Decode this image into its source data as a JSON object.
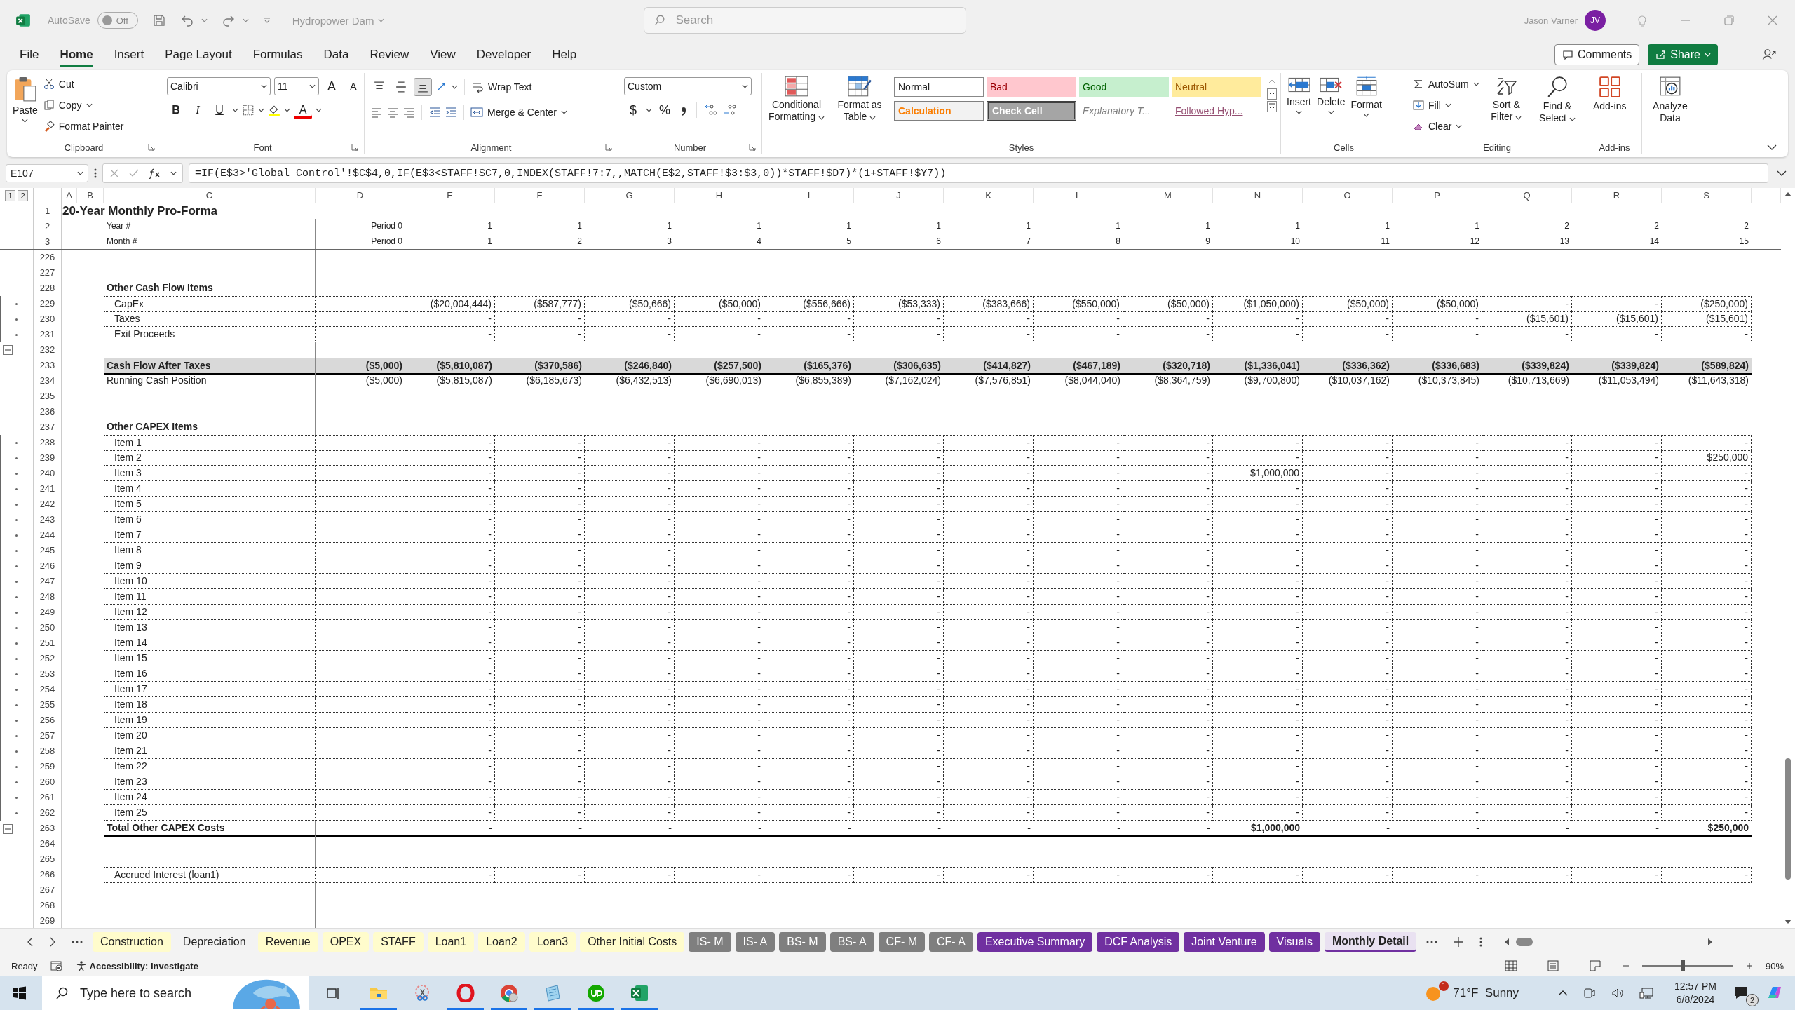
{
  "title_bar": {
    "autosave_label": "AutoSave",
    "autosave_toggle": {
      "on": false,
      "label": "Off"
    },
    "document": "Hydropower Dam",
    "search_placeholder": "Search",
    "user_name": "Jason Varner",
    "user_initials": "JV"
  },
  "menu_tabs": [
    {
      "label": "File",
      "selected": false
    },
    {
      "label": "Home",
      "selected": true
    },
    {
      "label": "Insert",
      "selected": false
    },
    {
      "label": "Page Layout",
      "selected": false
    },
    {
      "label": "Formulas",
      "selected": false
    },
    {
      "label": "Data",
      "selected": false
    },
    {
      "label": "Review",
      "selected": false
    },
    {
      "label": "View",
      "selected": false
    },
    {
      "label": "Developer",
      "selected": false
    },
    {
      "label": "Help",
      "selected": false
    }
  ],
  "comments_button": "Comments",
  "share_button": "Share",
  "ribbon": {
    "clipboard": {
      "paste": "Paste",
      "cut": "Cut",
      "copy": "Copy",
      "format_painter": "Format Painter",
      "group": "Clipboard"
    },
    "font": {
      "name": "Calibri",
      "size": "11",
      "grow": "A",
      "shrink": "A",
      "bold": "B",
      "italic": "I",
      "underline": "U",
      "font_color_letter": "A",
      "group": "Font"
    },
    "alignment": {
      "vertical": [
        {
          "selected": false
        },
        {
          "selected": false
        },
        {
          "selected": true
        }
      ],
      "wrap_text": "Wrap Text",
      "merge_center": "Merge & Center",
      "group": "Alignment"
    },
    "number": {
      "format": "Custom",
      "currency": "$",
      "percent": "%",
      "group": "Number"
    },
    "styles": {
      "conditional_formatting": "Conditional Formatting",
      "format_as_table": "Format as Table",
      "gallery": [
        {
          "label": "Normal",
          "kind": "normal"
        },
        {
          "label": "Bad",
          "kind": "bad"
        },
        {
          "label": "Good",
          "kind": "good"
        },
        {
          "label": "Neutral",
          "kind": "neutral"
        },
        {
          "label": "Calculation",
          "kind": "calculation"
        },
        {
          "label": "Check Cell",
          "kind": "check"
        },
        {
          "label": "Explanatory T...",
          "kind": "explanatory"
        },
        {
          "label": "Followed Hyp...",
          "kind": "hyperlink"
        }
      ],
      "group": "Styles"
    },
    "cells": {
      "insert": "Insert",
      "delete": "Delete",
      "format": "Format",
      "group": "Cells"
    },
    "editing": {
      "autosum": "AutoSum",
      "fill": "Fill",
      "clear": "Clear",
      "sort_filter": "Sort & Filter",
      "find_select": "Find & Select",
      "group": "Editing"
    },
    "addins": {
      "addins": "Add-ins",
      "group": "Add-ins"
    },
    "analyze_data": "Analyze Data"
  },
  "formula_bar": {
    "name_box": "E107",
    "formula": "=IF(E$3>'Global Control'!$C$4,0,IF(E$3<STAFF!$C7,0,INDEX(STAFF!7:7,,MATCH(E$2,STAFF!$3:$3,0))*STAFF!$D7)*(1+STAFF!$Y7))"
  },
  "outline_levels": [
    "1",
    "2"
  ],
  "sheet": {
    "columns": [
      "A",
      "B",
      "C",
      "D",
      "E",
      "F",
      "G",
      "H",
      "I",
      "J",
      "K",
      "L",
      "M",
      "N",
      "O",
      "P",
      "Q",
      "R",
      "S"
    ],
    "header_rows": [
      {
        "num": "1",
        "kind": "title",
        "label": "20-Year Monthly Pro-Forma"
      },
      {
        "num": "2",
        "kind": "period",
        "label": "Year #",
        "column_d": "Period 0",
        "values": [
          "1",
          "1",
          "1",
          "1",
          "1",
          "1",
          "1",
          "1",
          "1",
          "1",
          "1",
          "1",
          "2",
          "2",
          "2"
        ]
      },
      {
        "num": "3",
        "kind": "period",
        "label": "Month #",
        "column_d": "Period 0",
        "values": [
          "1",
          "2",
          "3",
          "4",
          "5",
          "6",
          "7",
          "8",
          "9",
          "10",
          "11",
          "12",
          "13",
          "14",
          "15"
        ]
      }
    ],
    "rows": [
      {
        "num": "226",
        "kind": "blank",
        "grouped": false,
        "collapse_button": false
      },
      {
        "num": "227",
        "kind": "blank",
        "grouped": false,
        "collapse_button": false
      },
      {
        "num": "228",
        "kind": "section",
        "grouped": false,
        "collapse_button": false,
        "label": "Other Cash Flow Items"
      },
      {
        "num": "229",
        "kind": "detail",
        "grouped": true,
        "collapse_button": false,
        "label": "CapEx",
        "values": [
          "($20,004,444)",
          "($587,777)",
          "($50,666)",
          "($50,000)",
          "($556,666)",
          "($53,333)",
          "($383,666)",
          "($550,000)",
          "($50,000)",
          "($1,050,000)",
          "($50,000)",
          "($50,000)",
          "-",
          "-",
          "($250,000)"
        ]
      },
      {
        "num": "230",
        "kind": "detail",
        "grouped": true,
        "collapse_button": false,
        "label": "Taxes",
        "values": [
          "-",
          "-",
          "-",
          "-",
          "-",
          "-",
          "-",
          "-",
          "-",
          "-",
          "-",
          "-",
          "($15,601)",
          "($15,601)",
          "($15,601)"
        ]
      },
      {
        "num": "231",
        "kind": "detail",
        "grouped": true,
        "collapse_button": false,
        "label": "Exit Proceeds",
        "values": [
          "-",
          "-",
          "-",
          "-",
          "-",
          "-",
          "-",
          "-",
          "-",
          "-",
          "-",
          "-",
          "-",
          "-",
          "-"
        ]
      },
      {
        "num": "232",
        "kind": "blank",
        "grouped": false,
        "collapse_button": true
      },
      {
        "num": "233",
        "kind": "band",
        "grouped": false,
        "collapse_button": false,
        "label": "Cash Flow After Taxes",
        "column_d": "($5,000)",
        "values": [
          "($5,810,087)",
          "($370,586)",
          "($246,840)",
          "($257,500)",
          "($165,376)",
          "($306,635)",
          "($414,827)",
          "($467,189)",
          "($320,718)",
          "($1,336,041)",
          "($336,362)",
          "($336,683)",
          "($339,824)",
          "($339,824)",
          "($589,824)"
        ]
      },
      {
        "num": "234",
        "kind": "plain",
        "grouped": false,
        "collapse_button": false,
        "label": "Running Cash Position",
        "column_d": "($5,000)",
        "values": [
          "($5,815,087)",
          "($6,185,673)",
          "($6,432,513)",
          "($6,690,013)",
          "($6,855,389)",
          "($7,162,024)",
          "($7,576,851)",
          "($8,044,040)",
          "($8,364,759)",
          "($9,700,800)",
          "($10,037,162)",
          "($10,373,845)",
          "($10,713,669)",
          "($11,053,494)",
          "($11,643,318)"
        ]
      },
      {
        "num": "235",
        "kind": "blank",
        "grouped": false,
        "collapse_button": false
      },
      {
        "num": "236",
        "kind": "blank",
        "grouped": false,
        "collapse_button": false
      },
      {
        "num": "237",
        "kind": "section",
        "grouped": false,
        "collapse_button": false,
        "label": "Other CAPEX Items"
      },
      {
        "num": "238",
        "kind": "detail",
        "grouped": true,
        "collapse_button": false,
        "label": "Item 1",
        "values": [
          "-",
          "-",
          "-",
          "-",
          "-",
          "-",
          "-",
          "-",
          "-",
          "-",
          "-",
          "-",
          "-",
          "-",
          "-"
        ]
      },
      {
        "num": "239",
        "kind": "detail",
        "grouped": true,
        "collapse_button": false,
        "label": "Item 2",
        "values": [
          "-",
          "-",
          "-",
          "-",
          "-",
          "-",
          "-",
          "-",
          "-",
          "-",
          "-",
          "-",
          "-",
          "-",
          "$250,000"
        ]
      },
      {
        "num": "240",
        "kind": "detail",
        "grouped": true,
        "collapse_button": false,
        "label": "Item 3",
        "values": [
          "-",
          "-",
          "-",
          "-",
          "-",
          "-",
          "-",
          "-",
          "-",
          "$1,000,000",
          "-",
          "-",
          "-",
          "-",
          "-"
        ]
      },
      {
        "num": "241",
        "kind": "detail",
        "grouped": true,
        "collapse_button": false,
        "label": "Item 4",
        "values": [
          "-",
          "-",
          "-",
          "-",
          "-",
          "-",
          "-",
          "-",
          "-",
          "-",
          "-",
          "-",
          "-",
          "-",
          "-"
        ]
      },
      {
        "num": "242",
        "kind": "detail",
        "grouped": true,
        "collapse_button": false,
        "label": "Item 5",
        "values": [
          "-",
          "-",
          "-",
          "-",
          "-",
          "-",
          "-",
          "-",
          "-",
          "-",
          "-",
          "-",
          "-",
          "-",
          "-"
        ]
      },
      {
        "num": "243",
        "kind": "detail",
        "grouped": true,
        "collapse_button": false,
        "label": "Item 6",
        "values": [
          "-",
          "-",
          "-",
          "-",
          "-",
          "-",
          "-",
          "-",
          "-",
          "-",
          "-",
          "-",
          "-",
          "-",
          "-"
        ]
      },
      {
        "num": "244",
        "kind": "detail",
        "grouped": true,
        "collapse_button": false,
        "label": "Item 7",
        "values": [
          "-",
          "-",
          "-",
          "-",
          "-",
          "-",
          "-",
          "-",
          "-",
          "-",
          "-",
          "-",
          "-",
          "-",
          "-"
        ]
      },
      {
        "num": "245",
        "kind": "detail",
        "grouped": true,
        "collapse_button": false,
        "label": "Item 8",
        "values": [
          "-",
          "-",
          "-",
          "-",
          "-",
          "-",
          "-",
          "-",
          "-",
          "-",
          "-",
          "-",
          "-",
          "-",
          "-"
        ]
      },
      {
        "num": "246",
        "kind": "detail",
        "grouped": true,
        "collapse_button": false,
        "label": "Item 9",
        "values": [
          "-",
          "-",
          "-",
          "-",
          "-",
          "-",
          "-",
          "-",
          "-",
          "-",
          "-",
          "-",
          "-",
          "-",
          "-"
        ]
      },
      {
        "num": "247",
        "kind": "detail",
        "grouped": true,
        "collapse_button": false,
        "label": "Item 10",
        "values": [
          "-",
          "-",
          "-",
          "-",
          "-",
          "-",
          "-",
          "-",
          "-",
          "-",
          "-",
          "-",
          "-",
          "-",
          "-"
        ]
      },
      {
        "num": "248",
        "kind": "detail",
        "grouped": true,
        "collapse_button": false,
        "label": "Item 11",
        "values": [
          "-",
          "-",
          "-",
          "-",
          "-",
          "-",
          "-",
          "-",
          "-",
          "-",
          "-",
          "-",
          "-",
          "-",
          "-"
        ]
      },
      {
        "num": "249",
        "kind": "detail",
        "grouped": true,
        "collapse_button": false,
        "label": "Item 12",
        "values": [
          "-",
          "-",
          "-",
          "-",
          "-",
          "-",
          "-",
          "-",
          "-",
          "-",
          "-",
          "-",
          "-",
          "-",
          "-"
        ]
      },
      {
        "num": "250",
        "kind": "detail",
        "grouped": true,
        "collapse_button": false,
        "label": "Item 13",
        "values": [
          "-",
          "-",
          "-",
          "-",
          "-",
          "-",
          "-",
          "-",
          "-",
          "-",
          "-",
          "-",
          "-",
          "-",
          "-"
        ]
      },
      {
        "num": "251",
        "kind": "detail",
        "grouped": true,
        "collapse_button": false,
        "label": "Item 14",
        "values": [
          "-",
          "-",
          "-",
          "-",
          "-",
          "-",
          "-",
          "-",
          "-",
          "-",
          "-",
          "-",
          "-",
          "-",
          "-"
        ]
      },
      {
        "num": "252",
        "kind": "detail",
        "grouped": true,
        "collapse_button": false,
        "label": "Item 15",
        "values": [
          "-",
          "-",
          "-",
          "-",
          "-",
          "-",
          "-",
          "-",
          "-",
          "-",
          "-",
          "-",
          "-",
          "-",
          "-"
        ]
      },
      {
        "num": "253",
        "kind": "detail",
        "grouped": true,
        "collapse_button": false,
        "label": "Item 16",
        "values": [
          "-",
          "-",
          "-",
          "-",
          "-",
          "-",
          "-",
          "-",
          "-",
          "-",
          "-",
          "-",
          "-",
          "-",
          "-"
        ]
      },
      {
        "num": "254",
        "kind": "detail",
        "grouped": true,
        "collapse_button": false,
        "label": "Item 17",
        "values": [
          "-",
          "-",
          "-",
          "-",
          "-",
          "-",
          "-",
          "-",
          "-",
          "-",
          "-",
          "-",
          "-",
          "-",
          "-"
        ]
      },
      {
        "num": "255",
        "kind": "detail",
        "grouped": true,
        "collapse_button": false,
        "label": "Item 18",
        "values": [
          "-",
          "-",
          "-",
          "-",
          "-",
          "-",
          "-",
          "-",
          "-",
          "-",
          "-",
          "-",
          "-",
          "-",
          "-"
        ]
      },
      {
        "num": "256",
        "kind": "detail",
        "grouped": true,
        "collapse_button": false,
        "label": "Item 19",
        "values": [
          "-",
          "-",
          "-",
          "-",
          "-",
          "-",
          "-",
          "-",
          "-",
          "-",
          "-",
          "-",
          "-",
          "-",
          "-"
        ]
      },
      {
        "num": "257",
        "kind": "detail",
        "grouped": true,
        "collapse_button": false,
        "label": "Item 20",
        "values": [
          "-",
          "-",
          "-",
          "-",
          "-",
          "-",
          "-",
          "-",
          "-",
          "-",
          "-",
          "-",
          "-",
          "-",
          "-"
        ]
      },
      {
        "num": "258",
        "kind": "detail",
        "grouped": true,
        "collapse_button": false,
        "label": "Item 21",
        "values": [
          "-",
          "-",
          "-",
          "-",
          "-",
          "-",
          "-",
          "-",
          "-",
          "-",
          "-",
          "-",
          "-",
          "-",
          "-"
        ]
      },
      {
        "num": "259",
        "kind": "detail",
        "grouped": true,
        "collapse_button": false,
        "label": "Item 22",
        "values": [
          "-",
          "-",
          "-",
          "-",
          "-",
          "-",
          "-",
          "-",
          "-",
          "-",
          "-",
          "-",
          "-",
          "-",
          "-"
        ]
      },
      {
        "num": "260",
        "kind": "detail",
        "grouped": true,
        "collapse_button": false,
        "label": "Item 23",
        "values": [
          "-",
          "-",
          "-",
          "-",
          "-",
          "-",
          "-",
          "-",
          "-",
          "-",
          "-",
          "-",
          "-",
          "-",
          "-"
        ]
      },
      {
        "num": "261",
        "kind": "detail",
        "grouped": true,
        "collapse_button": false,
        "label": "Item 24",
        "values": [
          "-",
          "-",
          "-",
          "-",
          "-",
          "-",
          "-",
          "-",
          "-",
          "-",
          "-",
          "-",
          "-",
          "-",
          "-"
        ]
      },
      {
        "num": "262",
        "kind": "detail",
        "grouped": true,
        "collapse_button": false,
        "label": "Item 25",
        "values": [
          "-",
          "-",
          "-",
          "-",
          "-",
          "-",
          "-",
          "-",
          "-",
          "-",
          "-",
          "-",
          "-",
          "-",
          "-"
        ]
      },
      {
        "num": "263",
        "kind": "total",
        "grouped": false,
        "collapse_button": true,
        "label": "Total Other CAPEX Costs",
        "values": [
          "-",
          "-",
          "-",
          "-",
          "-",
          "-",
          "-",
          "-",
          "-",
          "$1,000,000",
          "-",
          "-",
          "-",
          "-",
          "$250,000"
        ]
      },
      {
        "num": "264",
        "kind": "blank",
        "grouped": false,
        "collapse_button": false
      },
      {
        "num": "265",
        "kind": "blank",
        "grouped": false,
        "collapse_button": false
      },
      {
        "num": "266",
        "kind": "detail",
        "grouped": false,
        "collapse_button": false,
        "label": "Accrued Interest (loan1)",
        "values": [
          "-",
          "-",
          "-",
          "-",
          "-",
          "-",
          "-",
          "-",
          "-",
          "-",
          "-",
          "-",
          "-",
          "-",
          "-"
        ]
      },
      {
        "num": "267",
        "kind": "blank",
        "grouped": false,
        "collapse_button": false
      },
      {
        "num": "268",
        "kind": "blank",
        "grouped": false,
        "collapse_button": false
      },
      {
        "num": "269",
        "kind": "blank",
        "grouped": false,
        "collapse_button": false
      }
    ]
  },
  "sheet_tabs": [
    {
      "label": "Construction",
      "color": "#fffccc",
      "selected": false
    },
    {
      "label": "Depreciation",
      "selected": false
    },
    {
      "label": "Revenue",
      "color": "#fffccc",
      "selected": false
    },
    {
      "label": "OPEX",
      "color": "#fffccc",
      "selected": false
    },
    {
      "label": "STAFF",
      "color": "#fffccc",
      "selected": false
    },
    {
      "label": "Loan1",
      "color": "#fffccc",
      "selected": false
    },
    {
      "label": "Loan2",
      "color": "#fffccc",
      "selected": false
    },
    {
      "label": "Loan3",
      "color": "#fffccc",
      "selected": false
    },
    {
      "label": "Other Initial Costs",
      "color": "#fffccc",
      "selected": false
    },
    {
      "label": "IS- M",
      "color": "#7f7f7f",
      "selected": false
    },
    {
      "label": "IS- A",
      "color": "#7f7f7f",
      "selected": false
    },
    {
      "label": "BS- M",
      "color": "#7f7f7f",
      "selected": false
    },
    {
      "label": "BS- A",
      "color": "#7f7f7f",
      "selected": false
    },
    {
      "label": "CF- M",
      "color": "#7f7f7f",
      "selected": false
    },
    {
      "label": "CF- A",
      "color": "#7f7f7f",
      "selected": false
    },
    {
      "label": "Executive Summary",
      "color": "#7030a0",
      "selected": false
    },
    {
      "label": "DCF Analysis",
      "color": "#7030a0",
      "selected": false
    },
    {
      "label": "Joint Venture",
      "color": "#7030a0",
      "selected": false
    },
    {
      "label": "Visuals",
      "color": "#7030a0",
      "selected": false
    },
    {
      "label": "Monthly Detail",
      "color": "#7030a0",
      "selected": true
    }
  ],
  "status_bar": {
    "ready": "Ready",
    "accessibility": "Accessibility: Investigate",
    "zoom": {
      "level": 0.45,
      "label": "90%"
    }
  },
  "taskbar": {
    "search_placeholder": "Type here to search",
    "weather_badge": "1",
    "weather": "71°F  Sunny",
    "time": "12:57 PM",
    "date": "6/8/2024",
    "notification_count": "2"
  }
}
